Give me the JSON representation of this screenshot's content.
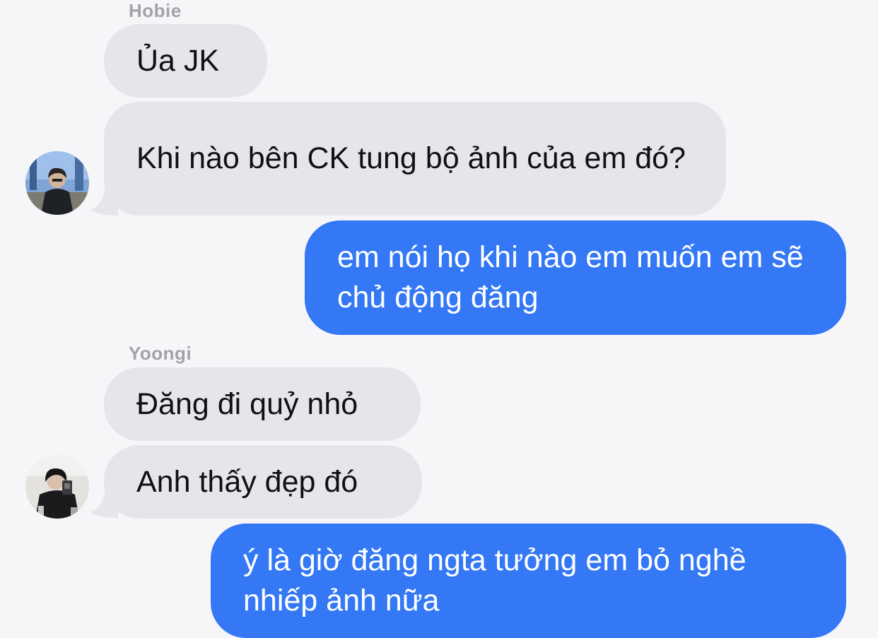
{
  "thread": {
    "group1": {
      "sender": "Hobie",
      "messages": [
        "Ủa JK",
        "Khi nào bên CK tung bộ ảnh của em đó?"
      ]
    },
    "reply1": "em nói họ khi nào em muốn em sẽ chủ động đăng",
    "group2": {
      "sender": "Yoongi",
      "messages": [
        "Đăng đi quỷ nhỏ",
        "Anh thấy đẹp đó"
      ]
    },
    "reply2": "ý là giờ đăng ngta tưởng em bỏ nghề nhiếp ảnh nữa"
  },
  "colors": {
    "background": "#f6f6f8",
    "incoming_bubble": "#e6e5eb",
    "outgoing_bubble": "#3478f6",
    "sender_label": "#a3a3a8"
  }
}
